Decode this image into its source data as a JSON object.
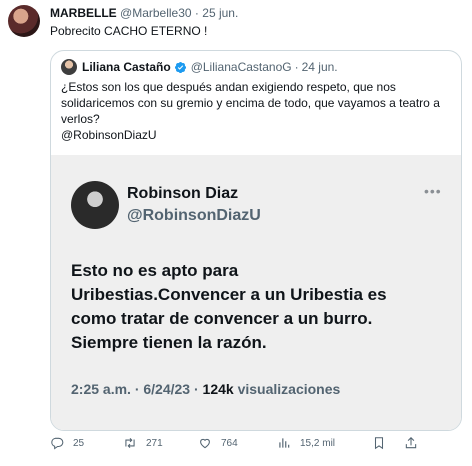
{
  "author": {
    "name": "MARBELLE",
    "handle": "@Marbelle30",
    "separator": "·",
    "date": "25 jun."
  },
  "text": "Pobrecito CACHO ETERNO !",
  "quoted": {
    "name": "Liliana Castaño",
    "handle": "@LilianaCastanoG",
    "separator": "·",
    "date": "24 jun.",
    "text_lines": [
      "¿Estos son los que después andan exigiendo respeto, que nos",
      "solidaricemos con su gremio y encima de todo, que vayamos a teatro a",
      "verlos?",
      "@RobinsonDiazU"
    ]
  },
  "card": {
    "name": "Robinson Diaz",
    "handle": "@RobinsonDiazU",
    "text_lines": [
      "Esto no es apto para",
      "Uribestias.Convencer a un Uribestia es",
      "como tratar de convencer a un burro.",
      "Siempre tienen la razón."
    ],
    "time_date": "2:25 a.m. · 6/24/23 ·",
    "views_count": "124k",
    "views_label": "visualizaciones"
  },
  "actions": {
    "replies": "25",
    "retweets": "271",
    "likes": "764",
    "views": "15,2 mil"
  },
  "icons": [
    "reply-icon",
    "retweet-icon",
    "like-icon",
    "views-icon",
    "bookmark-icon",
    "share-icon",
    "verified-icon",
    "more-icon"
  ],
  "colors": {
    "muted": "#536471",
    "verified": "#1d9bf0",
    "border": "#cfd9de",
    "card_bg": "#efefef"
  }
}
